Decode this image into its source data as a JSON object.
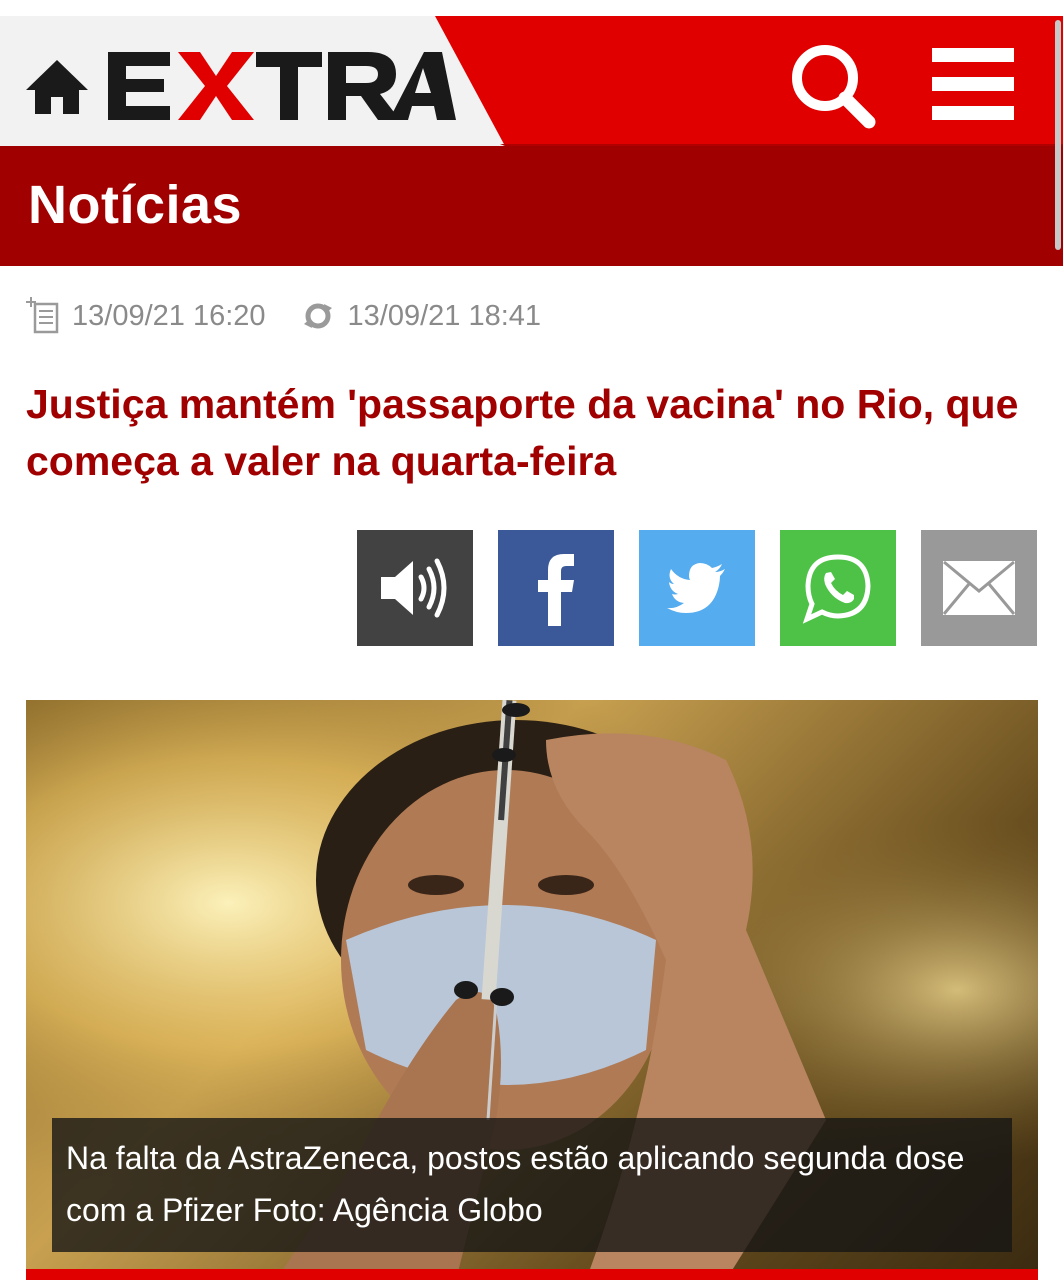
{
  "header": {
    "logo_text": "EXTRA",
    "home_icon": "home-icon",
    "search_icon": "search-icon",
    "menu_icon": "hamburger-menu-icon",
    "colors": {
      "brand_red": "#e00000",
      "dark_red": "#a10000",
      "logo_black": "#1a1a1a"
    }
  },
  "section": {
    "title": "Notícias"
  },
  "meta": {
    "published": "13/09/21 16:20",
    "updated": "13/09/21 18:41",
    "published_icon": "document-icon",
    "updated_icon": "update-icon"
  },
  "article": {
    "headline": "Justiça mantém 'passaporte da vacina' no Rio, que começa a valer na quarta-feira"
  },
  "share": [
    {
      "icon": "audio-speaker-icon",
      "color": "#424242"
    },
    {
      "icon": "facebook-icon",
      "color": "#3b5998"
    },
    {
      "icon": "twitter-icon",
      "color": "#55acee"
    },
    {
      "icon": "whatsapp-icon",
      "color": "#4dc247"
    },
    {
      "icon": "email-icon",
      "color": "#999999"
    }
  ],
  "photo": {
    "caption": "Na falta da AstraZeneca, postos estão aplicando segunda dose com a Pfizer Foto: Agência Globo"
  }
}
